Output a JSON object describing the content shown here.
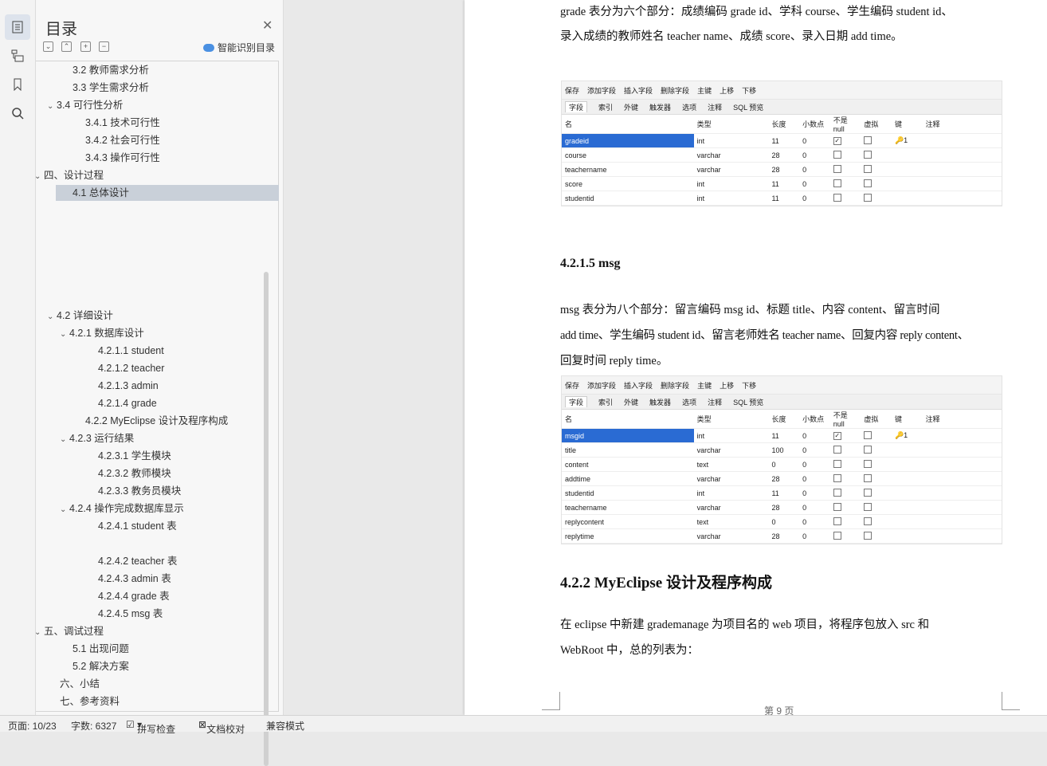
{
  "toc": {
    "title": "目录",
    "smart_toc": "智能识别目录",
    "items": [
      {
        "label": "3.2 教师需求分析"
      },
      {
        "label": "3.3 学生需求分析"
      },
      {
        "label": "3.4 可行性分析"
      },
      {
        "label": "3.4.1 技术可行性"
      },
      {
        "label": "3.4.2 社会可行性"
      },
      {
        "label": "3.4.3 操作可行性"
      },
      {
        "label": "四、设计过程"
      },
      {
        "label": "4.1 总体设计"
      },
      {
        "label": "4.2 详细设计"
      },
      {
        "label": "4.2.1 数据库设计"
      },
      {
        "label": "4.2.1.1 student"
      },
      {
        "label": "4.2.1.2 teacher"
      },
      {
        "label": "4.2.1.3 admin"
      },
      {
        "label": "4.2.1.4 grade"
      },
      {
        "label": "4.2.2 MyEclipse 设计及程序构成"
      },
      {
        "label": "4.2.3 运行结果"
      },
      {
        "label": "4.2.3.1  学生模块"
      },
      {
        "label": "4.2.3.2  教师模块"
      },
      {
        "label": "4.2.3.3  教务员模块"
      },
      {
        "label": "4.2.4  操作完成数据库显示"
      },
      {
        "label": "4.2.4.1 student 表"
      },
      {
        "label": "4.2.4.2 teacher 表"
      },
      {
        "label": "4.2.4.3 admin 表"
      },
      {
        "label": "4.2.4.4 grade 表"
      },
      {
        "label": "4.2.4.5 msg 表"
      },
      {
        "label": "五、调试过程"
      },
      {
        "label": "5.1 出现问题"
      },
      {
        "label": "5.2 解决方案"
      },
      {
        "label": "六、小结"
      },
      {
        "label": "七、参考资料"
      }
    ]
  },
  "doc": {
    "line_top": "grade 表分为六个部分：成绩编码 grade id、学科 course、学生编码 student id、",
    "line2": "录入成绩的教师姓名 teacher name、成绩 score、录入日期 add time。",
    "h_msg": "4.2.1.5 msg",
    "msg_p1": "msg 表分为八个部分：留言编码 msg id、标题 title、内容 content、留言时间",
    "msg_p2": "add time、学生编码 student id、留言老师姓名 teacher name、回复内容 reply content、",
    "msg_p3": "回复时间 reply time。",
    "h_myeclipse": "4.2.2 MyEclipse 设计及程序构成",
    "ecl_p1": "在 eclipse 中新建 grademanage 为项目名的 web 项目，将程序包放入 src 和",
    "ecl_p2": "WebRoot 中，总的列表为：",
    "page_num": "第 9 页"
  },
  "db_toolbar": {
    "save": "保存",
    "add": "添加字段",
    "insert": "插入字段",
    "delete": "删除字段",
    "pk": "主键",
    "up": "上移",
    "down": "下移"
  },
  "db_tabs": [
    "字段",
    "索引",
    "外键",
    "触发器",
    "选项",
    "注释",
    "SQL 预览"
  ],
  "db_headers": [
    "名",
    "类型",
    "长度",
    "小数点",
    "不是 null",
    "虚拟",
    "键",
    "注释"
  ],
  "grade_rows": [
    {
      "name": "gradeid",
      "type": "int",
      "len": "11",
      "dec": "0",
      "key": "1"
    },
    {
      "name": "course",
      "type": "varchar",
      "len": "28",
      "dec": "0",
      "key": ""
    },
    {
      "name": "teachername",
      "type": "varchar",
      "len": "28",
      "dec": "0",
      "key": ""
    },
    {
      "name": "score",
      "type": "int",
      "len": "11",
      "dec": "0",
      "key": ""
    },
    {
      "name": "studentid",
      "type": "int",
      "len": "11",
      "dec": "0",
      "key": ""
    }
  ],
  "msg_rows": [
    {
      "name": "msgid",
      "type": "int",
      "len": "11",
      "dec": "0",
      "key": "1"
    },
    {
      "name": "title",
      "type": "varchar",
      "len": "100",
      "dec": "0",
      "key": ""
    },
    {
      "name": "content",
      "type": "text",
      "len": "0",
      "dec": "0",
      "key": ""
    },
    {
      "name": "addtime",
      "type": "varchar",
      "len": "28",
      "dec": "0",
      "key": ""
    },
    {
      "name": "studentid",
      "type": "int",
      "len": "11",
      "dec": "0",
      "key": ""
    },
    {
      "name": "teachername",
      "type": "varchar",
      "len": "28",
      "dec": "0",
      "key": ""
    },
    {
      "name": "replycontent",
      "type": "text",
      "len": "0",
      "dec": "0",
      "key": ""
    },
    {
      "name": "replytime",
      "type": "varchar",
      "len": "28",
      "dec": "0",
      "key": ""
    }
  ],
  "status": {
    "page": "页面: 10/23",
    "words": "字数: 6327",
    "spell": "拼写检查",
    "proof": "文档校对",
    "compat": "兼容模式"
  }
}
